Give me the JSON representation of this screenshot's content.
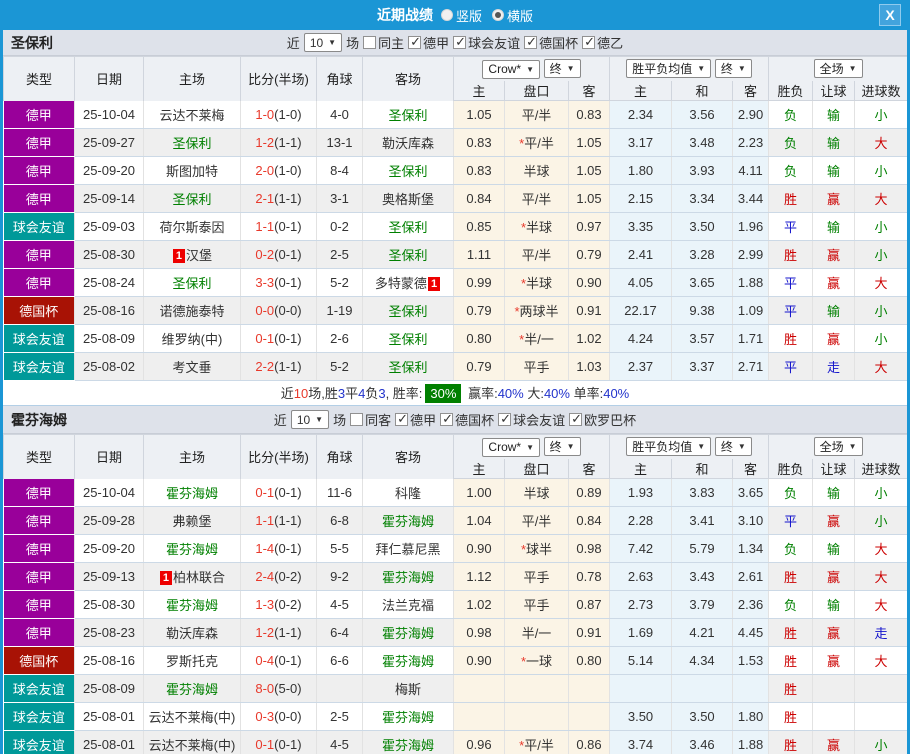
{
  "colors": {
    "titlebar_bg": "#1b96d5",
    "team_highlight": "#008000",
    "score_red": "#e8392b",
    "summary_badge_bg": "#008000",
    "league": {
      "德甲": "#99009a",
      "球会友谊": "#009999",
      "德国杯": "#a81205"
    },
    "result": {
      "r": "#cc0000",
      "g": "#008000",
      "b": "#1414cc"
    }
  },
  "titlebar": {
    "title": "近期战绩",
    "radios": [
      {
        "label": "竖版",
        "checked": false
      },
      {
        "label": "横版",
        "checked": true
      }
    ],
    "close_label": "X"
  },
  "table_header": {
    "bookmaker": "Crow*",
    "final1": "终",
    "avg": "胜平负均值",
    "final2": "终",
    "fulltime": "全场",
    "cols": {
      "type": "类型",
      "date": "日期",
      "home": "主场",
      "score": "比分(半场)",
      "corner": "角球",
      "away": "客场",
      "h": "主",
      "handicap": "盘口",
      "a": "客",
      "avg_h": "主",
      "avg_d": "和",
      "avg_a": "客",
      "wdl": "胜负",
      "let": "让球",
      "goals": "进球数"
    }
  },
  "sections": [
    {
      "team": "圣保利",
      "filters": {
        "near": "近",
        "count": "10",
        "unit": "场",
        "same": {
          "label": "同主",
          "checked": false
        },
        "leagues": [
          {
            "label": "德甲",
            "checked": true
          },
          {
            "label": "球会友谊",
            "checked": true
          },
          {
            "label": "德国杯",
            "checked": true
          },
          {
            "label": "德乙",
            "checked": true
          }
        ]
      },
      "rows": [
        {
          "type": "德甲",
          "date": "25-10-04",
          "home": "云达不莱梅",
          "home_green": false,
          "home_badge": "",
          "score": "1-0",
          "half": "(1-0)",
          "corner": "4-0",
          "away": "圣保利",
          "away_green": true,
          "away_badge": "",
          "o1": "1.05",
          "star": false,
          "handicap": "平/半",
          "o2": "0.83",
          "m1": "2.34",
          "m2": "3.56",
          "m3": "2.90",
          "r1": [
            "负",
            "g"
          ],
          "r2": [
            "输",
            "g"
          ],
          "r3": [
            "小",
            "g"
          ]
        },
        {
          "type": "德甲",
          "date": "25-09-27",
          "home": "圣保利",
          "home_green": true,
          "home_badge": "",
          "score": "1-2",
          "half": "(1-1)",
          "corner": "13-1",
          "away": "勒沃库森",
          "away_green": false,
          "away_badge": "",
          "o1": "0.83",
          "star": true,
          "handicap": "平/半",
          "o2": "1.05",
          "m1": "3.17",
          "m2": "3.48",
          "m3": "2.23",
          "r1": [
            "负",
            "g"
          ],
          "r2": [
            "输",
            "g"
          ],
          "r3": [
            "大",
            "r"
          ]
        },
        {
          "type": "德甲",
          "date": "25-09-20",
          "home": "斯图加特",
          "home_green": false,
          "home_badge": "",
          "score": "2-0",
          "half": "(1-0)",
          "corner": "8-4",
          "away": "圣保利",
          "away_green": true,
          "away_badge": "",
          "o1": "0.83",
          "star": false,
          "handicap": "半球",
          "o2": "1.05",
          "m1": "1.80",
          "m2": "3.93",
          "m3": "4.11",
          "r1": [
            "负",
            "g"
          ],
          "r2": [
            "输",
            "g"
          ],
          "r3": [
            "小",
            "g"
          ]
        },
        {
          "type": "德甲",
          "date": "25-09-14",
          "home": "圣保利",
          "home_green": true,
          "home_badge": "",
          "score": "2-1",
          "half": "(1-1)",
          "corner": "3-1",
          "away": "奥格斯堡",
          "away_green": false,
          "away_badge": "",
          "o1": "0.84",
          "star": false,
          "handicap": "平/半",
          "o2": "1.05",
          "m1": "2.15",
          "m2": "3.34",
          "m3": "3.44",
          "r1": [
            "胜",
            "r"
          ],
          "r2": [
            "赢",
            "r"
          ],
          "r3": [
            "大",
            "r"
          ]
        },
        {
          "type": "球会友谊",
          "date": "25-09-03",
          "home": "荷尔斯泰因",
          "home_green": false,
          "home_badge": "",
          "score": "1-1",
          "half": "(0-1)",
          "corner": "0-2",
          "away": "圣保利",
          "away_green": true,
          "away_badge": "",
          "o1": "0.85",
          "star": true,
          "handicap": "半球",
          "o2": "0.97",
          "m1": "3.35",
          "m2": "3.50",
          "m3": "1.96",
          "r1": [
            "平",
            "b"
          ],
          "r2": [
            "输",
            "g"
          ],
          "r3": [
            "小",
            "g"
          ]
        },
        {
          "type": "德甲",
          "date": "25-08-30",
          "home": "汉堡",
          "home_green": false,
          "home_badge": "1",
          "score": "0-2",
          "half": "(0-1)",
          "corner": "2-5",
          "away": "圣保利",
          "away_green": true,
          "away_badge": "",
          "o1": "1.11",
          "star": false,
          "handicap": "平/半",
          "o2": "0.79",
          "m1": "2.41",
          "m2": "3.28",
          "m3": "2.99",
          "r1": [
            "胜",
            "r"
          ],
          "r2": [
            "赢",
            "r"
          ],
          "r3": [
            "小",
            "g"
          ]
        },
        {
          "type": "德甲",
          "date": "25-08-24",
          "home": "圣保利",
          "home_green": true,
          "home_badge": "",
          "score": "3-3",
          "half": "(0-1)",
          "corner": "5-2",
          "away": "多特蒙德",
          "away_green": false,
          "away_badge": "1",
          "o1": "0.99",
          "star": true,
          "handicap": "半球",
          "o2": "0.90",
          "m1": "4.05",
          "m2": "3.65",
          "m3": "1.88",
          "r1": [
            "平",
            "b"
          ],
          "r2": [
            "赢",
            "r"
          ],
          "r3": [
            "大",
            "r"
          ]
        },
        {
          "type": "德国杯",
          "date": "25-08-16",
          "home": "诺德施泰特",
          "home_green": false,
          "home_badge": "",
          "score": "0-0",
          "half": "(0-0)",
          "corner": "1-19",
          "away": "圣保利",
          "away_green": true,
          "away_badge": "",
          "o1": "0.79",
          "star": true,
          "handicap": "两球半",
          "o2": "0.91",
          "m1": "22.17",
          "m2": "9.38",
          "m3": "1.09",
          "r1": [
            "平",
            "b"
          ],
          "r2": [
            "输",
            "g"
          ],
          "r3": [
            "小",
            "g"
          ]
        },
        {
          "type": "球会友谊",
          "date": "25-08-09",
          "home": "维罗纳(中)",
          "home_green": false,
          "home_badge": "",
          "score": "0-1",
          "half": "(0-1)",
          "corner": "2-6",
          "away": "圣保利",
          "away_green": true,
          "away_badge": "",
          "o1": "0.80",
          "star": true,
          "handicap": "半/一",
          "o2": "1.02",
          "m1": "4.24",
          "m2": "3.57",
          "m3": "1.71",
          "r1": [
            "胜",
            "r"
          ],
          "r2": [
            "赢",
            "r"
          ],
          "r3": [
            "小",
            "g"
          ]
        },
        {
          "type": "球会友谊",
          "date": "25-08-02",
          "home": "考文垂",
          "home_green": false,
          "home_badge": "",
          "score": "2-2",
          "half": "(1-1)",
          "corner": "5-2",
          "away": "圣保利",
          "away_green": true,
          "away_badge": "",
          "o1": "0.79",
          "star": false,
          "handicap": "平手",
          "o2": "1.03",
          "m1": "2.37",
          "m2": "3.37",
          "m3": "2.71",
          "r1": [
            "平",
            "b"
          ],
          "r2": [
            "走",
            "b"
          ],
          "r3": [
            "大",
            "r"
          ]
        }
      ],
      "summary": {
        "parts": [
          {
            "t": "近",
            "c": "dark"
          },
          {
            "t": "10",
            "c": "red"
          },
          {
            "t": "场,胜",
            "c": "dark"
          },
          {
            "t": "3",
            "c": "blue"
          },
          {
            "t": "平",
            "c": "dark"
          },
          {
            "t": "4",
            "c": "blue"
          },
          {
            "t": "负",
            "c": "dark"
          },
          {
            "t": "3",
            "c": "blue"
          },
          {
            "t": ", 胜率:",
            "c": "dark"
          },
          {
            "t": "30%",
            "c": "badge"
          },
          {
            "t": " 赢率:",
            "c": "dark"
          },
          {
            "t": "40%",
            "c": "blue"
          },
          {
            "t": " 大:",
            "c": "dark"
          },
          {
            "t": "40%",
            "c": "blue"
          },
          {
            "t": " 单率:",
            "c": "dark"
          },
          {
            "t": "40%",
            "c": "blue"
          }
        ]
      }
    },
    {
      "team": "霍芬海姆",
      "filters": {
        "near": "近",
        "count": "10",
        "unit": "场",
        "same": {
          "label": "同客",
          "checked": false
        },
        "leagues": [
          {
            "label": "德甲",
            "checked": true
          },
          {
            "label": "德国杯",
            "checked": true
          },
          {
            "label": "球会友谊",
            "checked": true
          },
          {
            "label": "欧罗巴杯",
            "checked": true
          }
        ]
      },
      "rows": [
        {
          "type": "德甲",
          "date": "25-10-04",
          "home": "霍芬海姆",
          "home_green": true,
          "home_badge": "",
          "score": "0-1",
          "half": "(0-1)",
          "corner": "11-6",
          "away": "科隆",
          "away_green": false,
          "away_badge": "",
          "o1": "1.00",
          "star": false,
          "handicap": "半球",
          "o2": "0.89",
          "m1": "1.93",
          "m2": "3.83",
          "m3": "3.65",
          "r1": [
            "负",
            "g"
          ],
          "r2": [
            "输",
            "g"
          ],
          "r3": [
            "小",
            "g"
          ]
        },
        {
          "type": "德甲",
          "date": "25-09-28",
          "home": "弗赖堡",
          "home_green": false,
          "home_badge": "",
          "score": "1-1",
          "half": "(1-1)",
          "corner": "6-8",
          "away": "霍芬海姆",
          "away_green": true,
          "away_badge": "",
          "o1": "1.04",
          "star": false,
          "handicap": "平/半",
          "o2": "0.84",
          "m1": "2.28",
          "m2": "3.41",
          "m3": "3.10",
          "r1": [
            "平",
            "b"
          ],
          "r2": [
            "赢",
            "r"
          ],
          "r3": [
            "小",
            "g"
          ]
        },
        {
          "type": "德甲",
          "date": "25-09-20",
          "home": "霍芬海姆",
          "home_green": true,
          "home_badge": "",
          "score": "1-4",
          "half": "(0-1)",
          "corner": "5-5",
          "away": "拜仁慕尼黑",
          "away_green": false,
          "away_badge": "",
          "o1": "0.90",
          "star": true,
          "handicap": "球半",
          "o2": "0.98",
          "m1": "7.42",
          "m2": "5.79",
          "m3": "1.34",
          "r1": [
            "负",
            "g"
          ],
          "r2": [
            "输",
            "g"
          ],
          "r3": [
            "大",
            "r"
          ]
        },
        {
          "type": "德甲",
          "date": "25-09-13",
          "home": "柏林联合",
          "home_green": false,
          "home_badge": "1",
          "score": "2-4",
          "half": "(0-2)",
          "corner": "9-2",
          "away": "霍芬海姆",
          "away_green": true,
          "away_badge": "",
          "o1": "1.12",
          "star": false,
          "handicap": "平手",
          "o2": "0.78",
          "m1": "2.63",
          "m2": "3.43",
          "m3": "2.61",
          "r1": [
            "胜",
            "r"
          ],
          "r2": [
            "赢",
            "r"
          ],
          "r3": [
            "大",
            "r"
          ]
        },
        {
          "type": "德甲",
          "date": "25-08-30",
          "home": "霍芬海姆",
          "home_green": true,
          "home_badge": "",
          "score": "1-3",
          "half": "(0-2)",
          "corner": "4-5",
          "away": "法兰克福",
          "away_green": false,
          "away_badge": "",
          "o1": "1.02",
          "star": false,
          "handicap": "平手",
          "o2": "0.87",
          "m1": "2.73",
          "m2": "3.79",
          "m3": "2.36",
          "r1": [
            "负",
            "g"
          ],
          "r2": [
            "输",
            "g"
          ],
          "r3": [
            "大",
            "r"
          ]
        },
        {
          "type": "德甲",
          "date": "25-08-23",
          "home": "勒沃库森",
          "home_green": false,
          "home_badge": "",
          "score": "1-2",
          "half": "(1-1)",
          "corner": "6-4",
          "away": "霍芬海姆",
          "away_green": true,
          "away_badge": "",
          "o1": "0.98",
          "star": false,
          "handicap": "半/一",
          "o2": "0.91",
          "m1": "1.69",
          "m2": "4.21",
          "m3": "4.45",
          "r1": [
            "胜",
            "r"
          ],
          "r2": [
            "赢",
            "r"
          ],
          "r3": [
            "走",
            "b"
          ]
        },
        {
          "type": "德国杯",
          "date": "25-08-16",
          "home": "罗斯托克",
          "home_green": false,
          "home_badge": "",
          "score": "0-4",
          "half": "(0-1)",
          "corner": "6-6",
          "away": "霍芬海姆",
          "away_green": true,
          "away_badge": "",
          "o1": "0.90",
          "star": true,
          "handicap": "一球",
          "o2": "0.80",
          "m1": "5.14",
          "m2": "4.34",
          "m3": "1.53",
          "r1": [
            "胜",
            "r"
          ],
          "r2": [
            "赢",
            "r"
          ],
          "r3": [
            "大",
            "r"
          ]
        },
        {
          "type": "球会友谊",
          "date": "25-08-09",
          "home": "霍芬海姆",
          "home_green": true,
          "home_badge": "",
          "score": "8-0",
          "half": "(5-0)",
          "corner": "",
          "away": "梅斯",
          "away_green": false,
          "away_badge": "",
          "o1": "",
          "star": false,
          "handicap": "",
          "o2": "",
          "m1": "",
          "m2": "",
          "m3": "",
          "r1": [
            "胜",
            "r"
          ],
          "r2": null,
          "r3": null
        },
        {
          "type": "球会友谊",
          "date": "25-08-01",
          "home": "云达不莱梅(中)",
          "home_green": false,
          "home_badge": "",
          "score": "0-3",
          "half": "(0-0)",
          "corner": "2-5",
          "away": "霍芬海姆",
          "away_green": true,
          "away_badge": "",
          "o1": "",
          "star": false,
          "handicap": "",
          "o2": "",
          "m1": "3.50",
          "m2": "3.50",
          "m3": "1.80",
          "r1": [
            "胜",
            "r"
          ],
          "r2": null,
          "r3": null
        },
        {
          "type": "球会友谊",
          "date": "25-08-01",
          "home": "云达不莱梅(中)",
          "home_green": false,
          "home_badge": "",
          "score": "0-1",
          "half": "(0-1)",
          "corner": "4-5",
          "away": "霍芬海姆",
          "away_green": true,
          "away_badge": "",
          "o1": "0.96",
          "star": true,
          "handicap": "平/半",
          "o2": "0.86",
          "m1": "3.74",
          "m2": "3.46",
          "m3": "1.88",
          "r1": [
            "胜",
            "r"
          ],
          "r2": [
            "赢",
            "r"
          ],
          "r3": [
            "小",
            "g"
          ]
        }
      ]
    }
  ]
}
